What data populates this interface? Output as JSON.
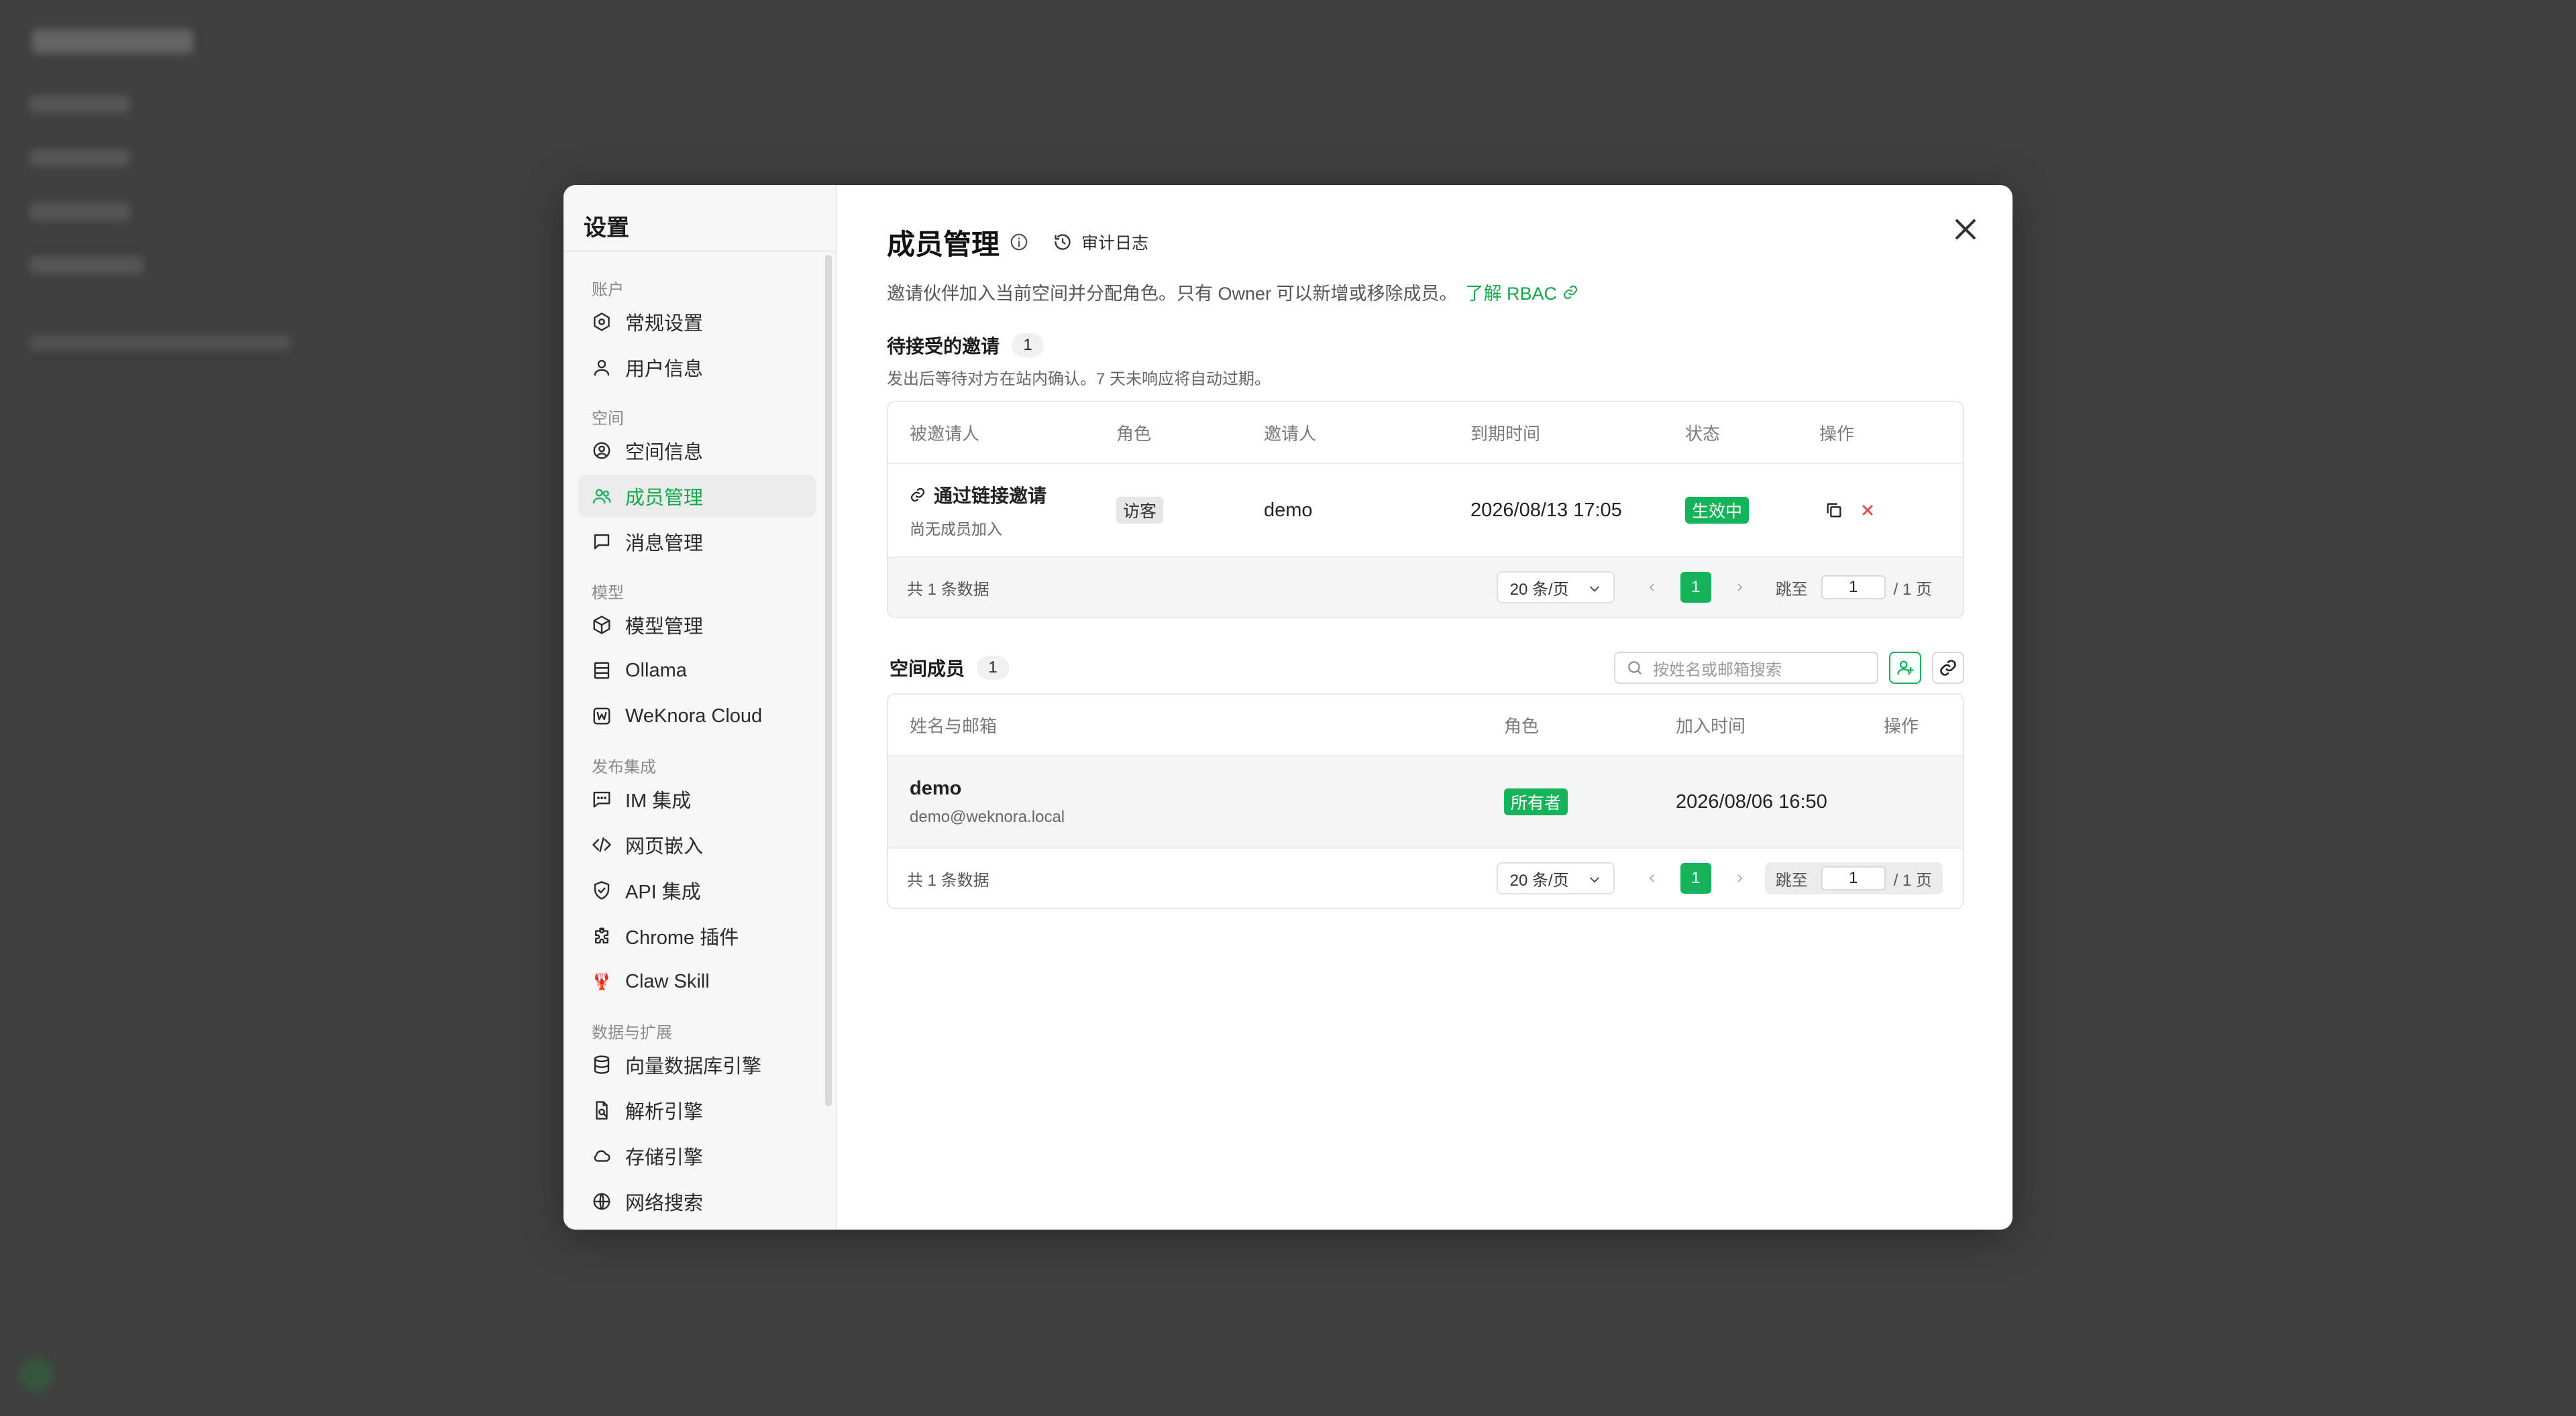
{
  "modal": {
    "title": "设置",
    "groups": [
      {
        "label": "账户",
        "items": [
          {
            "label": "常规设置",
            "icon": "settings-hex-icon"
          },
          {
            "label": "用户信息",
            "icon": "user-icon"
          }
        ]
      },
      {
        "label": "空间",
        "items": [
          {
            "label": "空间信息",
            "icon": "user-circle-icon"
          },
          {
            "label": "成员管理",
            "icon": "users-icon",
            "active": true
          },
          {
            "label": "消息管理",
            "icon": "message-square-icon"
          }
        ]
      },
      {
        "label": "模型",
        "items": [
          {
            "label": "模型管理",
            "icon": "cube-icon"
          },
          {
            "label": "Ollama",
            "icon": "server-icon"
          },
          {
            "label": "WeKnora Cloud",
            "icon": "weknora-cloud-icon"
          }
        ]
      },
      {
        "label": "发布集成",
        "items": [
          {
            "label": "IM 集成",
            "icon": "chat-dots-icon"
          },
          {
            "label": "网页嵌入",
            "icon": "code-icon"
          },
          {
            "label": "API 集成",
            "icon": "shield-check-icon"
          },
          {
            "label": "Chrome 插件",
            "icon": "puzzle-icon"
          },
          {
            "label": "Claw Skill",
            "icon": "lobster-icon"
          }
        ]
      },
      {
        "label": "数据与扩展",
        "items": [
          {
            "label": "向量数据库引擎",
            "icon": "database-icon"
          },
          {
            "label": "解析引擎",
            "icon": "file-search-icon"
          },
          {
            "label": "存储引擎",
            "icon": "cloud-icon"
          },
          {
            "label": "网络搜索",
            "icon": "globe-icon"
          }
        ]
      }
    ]
  },
  "page": {
    "title": "成员管理",
    "audit_label": "审计日志",
    "description": "邀请伙伴加入当前空间并分配角色。只有 Owner 可以新增或移除成员。",
    "rbac_link": "了解 RBAC"
  },
  "invites": {
    "title": "待接受的邀请",
    "count": "1",
    "subtitle": "发出后等待对方在站内确认。7 天未响应将自动过期。",
    "columns": [
      "被邀请人",
      "角色",
      "邀请人",
      "到期时间",
      "状态",
      "操作"
    ],
    "row": {
      "invitee": "通过链接邀请",
      "invitee_sub": "尚无成员加入",
      "role": "访客",
      "inviter": "demo",
      "expires": "2026/08/13 17:05",
      "status": "生效中"
    },
    "footer": {
      "total": "共 1 条数据",
      "page_size": "20 条/页",
      "page": "1",
      "jump_label": "跳至",
      "jump_value": "1",
      "total_pages": "/ 1 页"
    }
  },
  "members": {
    "title": "空间成员",
    "count": "1",
    "search_placeholder": "按姓名或邮箱搜索",
    "columns": [
      "姓名与邮箱",
      "角色",
      "加入时间",
      "操作"
    ],
    "row": {
      "name": "demo",
      "email": "demo@weknora.local",
      "role": "所有者",
      "joined": "2026/08/06 16:50"
    },
    "footer": {
      "total": "共 1 条数据",
      "page_size": "20 条/页",
      "page": "1",
      "jump_label": "跳至",
      "jump_value": "1",
      "total_pages": "/ 1 页"
    }
  },
  "colors": {
    "accent": "#16b45a",
    "danger": "#e5484d"
  }
}
